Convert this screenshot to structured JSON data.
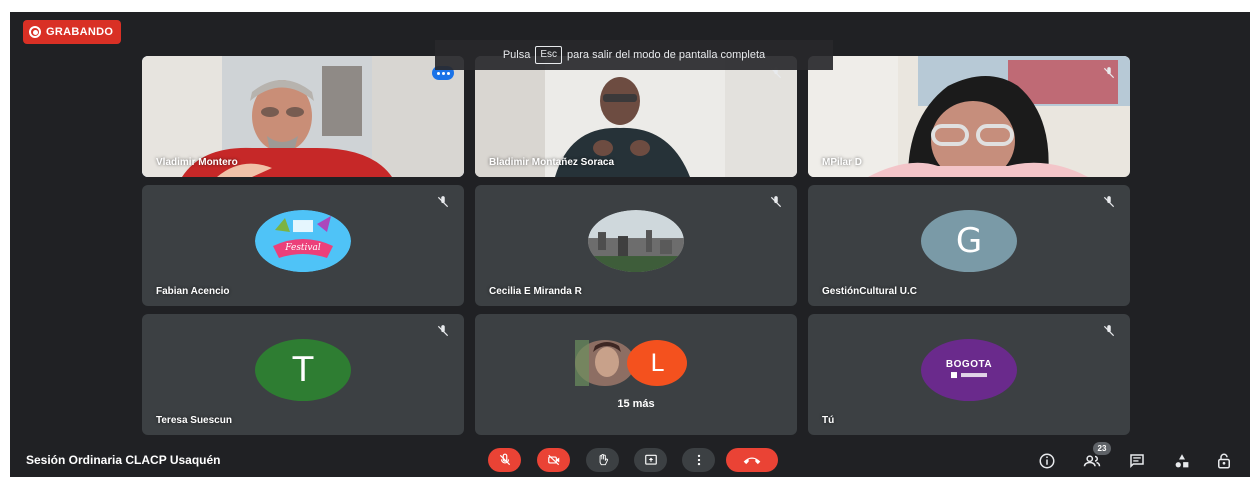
{
  "recording": {
    "label": "GRABANDO"
  },
  "fullscreen_banner": {
    "prefix": "Pulsa",
    "key": "Esc",
    "suffix": "para salir del modo de pantalla completa"
  },
  "participants": [
    {
      "name": "Vladimir Montero",
      "kind": "video",
      "speaking": true
    },
    {
      "name": "Bladimir Montañez Soraca",
      "kind": "video"
    },
    {
      "name": "MPilar D",
      "kind": "video"
    },
    {
      "name": "Fabian Acencio",
      "kind": "avatar-image"
    },
    {
      "name": "Cecilia E Miranda R",
      "kind": "avatar-image"
    },
    {
      "name": "GestiónCultural U.C",
      "kind": "letter",
      "letter": "G",
      "color": "#7a9aa7"
    },
    {
      "name": "Teresa Suescun",
      "kind": "letter",
      "letter": "T",
      "color": "#2e7d32"
    },
    {
      "name": "",
      "kind": "group",
      "letter": "L",
      "color": "#f4511e",
      "more_label": "15 más"
    },
    {
      "name": "Tú",
      "kind": "avatar-image"
    }
  ],
  "bogota_logo": {
    "word": "BOGOTA"
  },
  "bottom_bar": {
    "meeting_title": "Sesión Ordinaria CLACP Usaquén",
    "participant_count": "23"
  },
  "colors": {
    "background": "#202124",
    "tile": "#3c4043",
    "recording": "#d93025",
    "hangup": "#ea4335",
    "speaking_outline": "#8ab4f8"
  },
  "icons": [
    "mic-off-icon",
    "camera-off-icon",
    "raise-hand-icon",
    "present-screen-icon",
    "more-options-icon",
    "hangup-icon",
    "info-icon",
    "people-icon",
    "chat-icon",
    "activities-icon",
    "host-controls-icon"
  ]
}
